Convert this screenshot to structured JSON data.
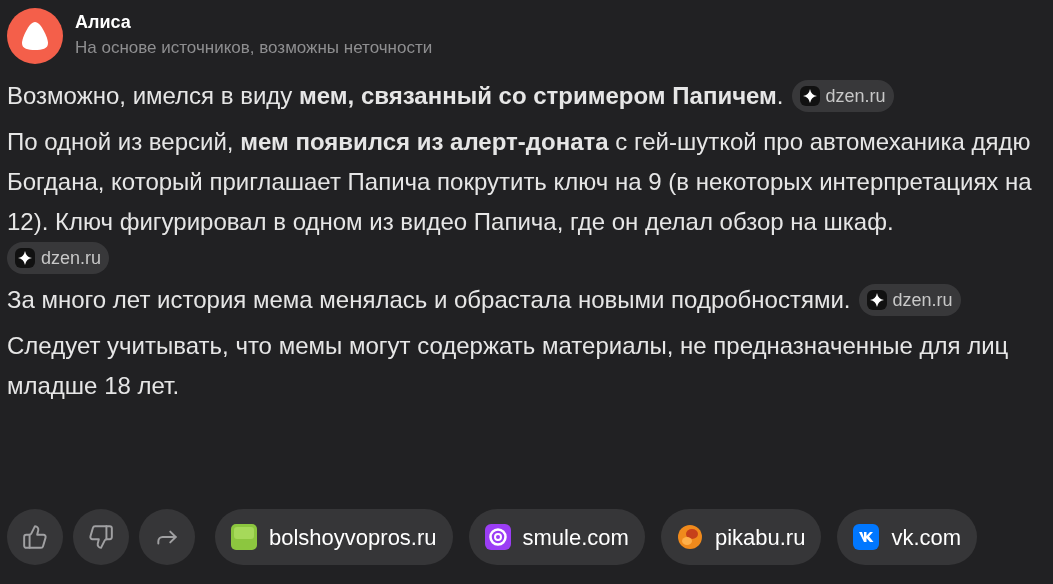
{
  "header": {
    "title": "Алиса",
    "subtitle": "На основе источников, возможны неточности"
  },
  "paragraphs": [
    {
      "text": "Возможно, имелся в виду **мем, связанный со стримером Папичем**.",
      "source": "dzen.ru"
    },
    {
      "text": "По одной из версий, **мем появился из алерт-доната** с гей-шуткой про автомеханика дядю Богдана, который приглашает Папича покрутить ключ на 9 (в некоторых интерпретациях на 12). Ключ фигурировал в одном из видео Папича, где он делал обзор на шкаф.",
      "source": "dzen.ru"
    },
    {
      "text": "За много лет история мема менялась и обрастала новыми подробностями.",
      "source": "dzen.ru"
    },
    {
      "text": "Следует учитывать, что мемы могут содержать материалы, не предназначенные для лиц младше 18 лет."
    }
  ],
  "actions": [
    {
      "kind": "like"
    },
    {
      "kind": "dislike"
    },
    {
      "kind": "share"
    }
  ],
  "sources": [
    {
      "kind": "question",
      "label": "bolshoyvopros.ru"
    },
    {
      "kind": "ring",
      "label": "smule.com"
    },
    {
      "kind": "ball",
      "label": "pikabu.ru"
    },
    {
      "kind": "vk",
      "label": "vk.com"
    }
  ]
}
